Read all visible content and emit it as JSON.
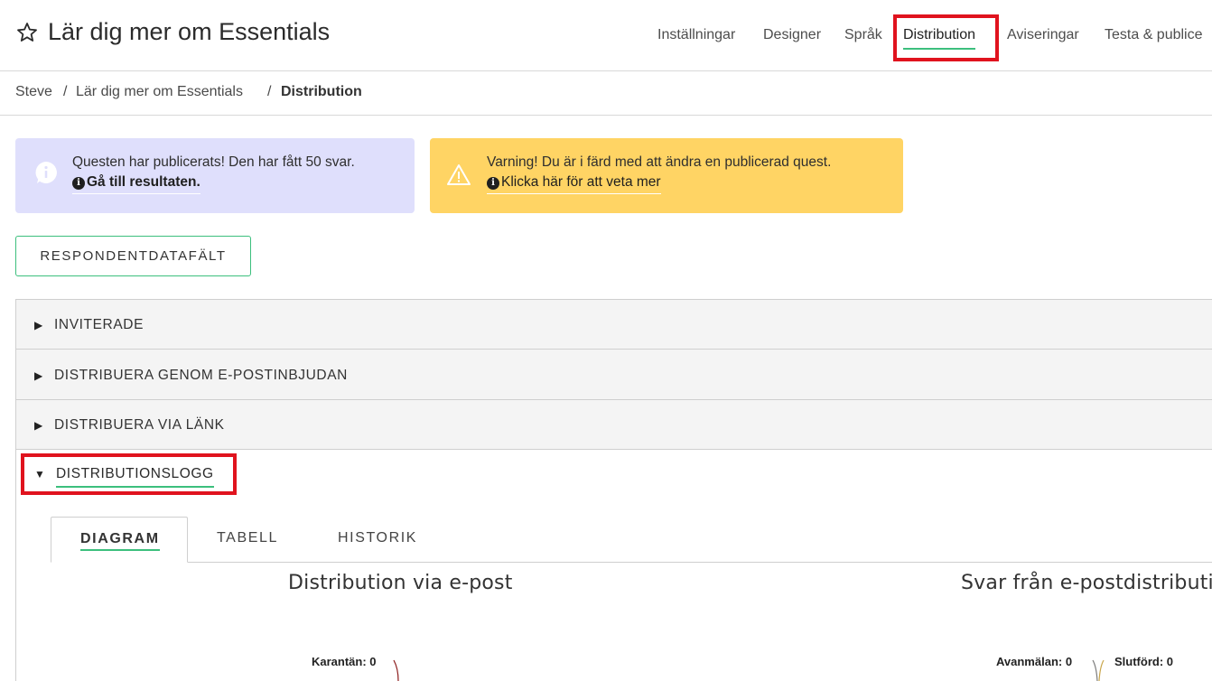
{
  "header": {
    "title": "Lär dig mer om Essentials",
    "star_icon": "star-outline-icon",
    "nav": [
      {
        "label": "Inställningar",
        "active": false
      },
      {
        "label": "Designer",
        "active": false
      },
      {
        "label": "Språk",
        "active": false
      },
      {
        "label": "Distribution",
        "active": true
      },
      {
        "label": "Aviseringar",
        "active": false
      },
      {
        "label": "Testa & publice",
        "active": false
      }
    ]
  },
  "breadcrumb": {
    "items": [
      "Steve",
      "Lär dig mer om Essentials",
      "Distribution"
    ],
    "separator": "/"
  },
  "alerts": {
    "info": {
      "message": "Questen har publicerats! Den har fått 50 svar.",
      "link": "Gå till resultaten.",
      "icon": "info-bubble-icon",
      "color": "#dfdffc"
    },
    "warning": {
      "message": "Varning! Du är i färd med att ändra en publicerad quest.",
      "link": "Klicka här för att veta mer",
      "icon": "warning-triangle-icon",
      "color": "#ffd464"
    }
  },
  "respondent_button": {
    "label": "RESPONDENTDATAFÄLT"
  },
  "accordion": [
    {
      "label": "INVITERADE",
      "expanded": false
    },
    {
      "label": "DISTRIBUERA GENOM E-POSTINBJUDAN",
      "expanded": false
    },
    {
      "label": "DISTRIBUERA VIA LÄNK",
      "expanded": false
    },
    {
      "label": "DISTRIBUTIONSLOGG",
      "expanded": true
    }
  ],
  "tabs": [
    {
      "label": "DIAGRAM",
      "active": true
    },
    {
      "label": "TABELL",
      "active": false
    },
    {
      "label": "HISTORIK",
      "active": false
    }
  ],
  "charts": [
    {
      "title": "Distribution via e-post",
      "labels": [
        "Karantän: 0"
      ]
    },
    {
      "title": "Svar från e-postdistributio",
      "labels": [
        "Avanmälan: 0",
        "Slutförd: 0"
      ]
    }
  ],
  "colors": {
    "accent": "#3cbf7d",
    "highlight": "#e0131e"
  }
}
